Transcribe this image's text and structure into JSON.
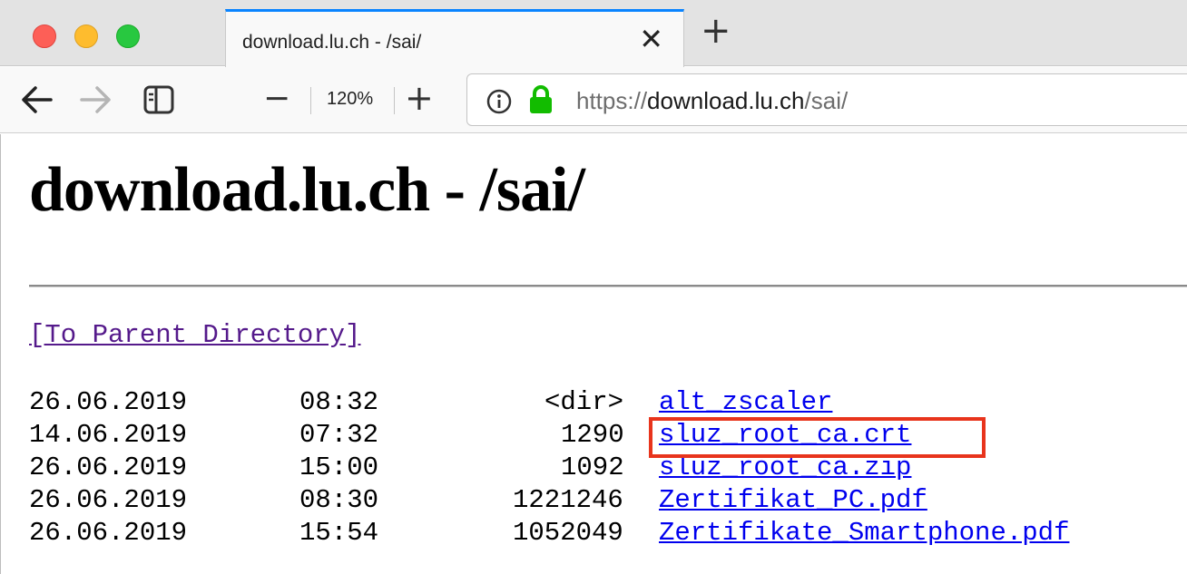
{
  "tab": {
    "title": "download.lu.ch - /sai/",
    "close_glyph": "✕",
    "new_tab_glyph": "+"
  },
  "nav": {
    "back_icon": "back-arrow-icon",
    "forward_icon": "forward-arrow-icon",
    "reader_icon": "reader-view-icon",
    "zoom_out_glyph": "−",
    "zoom_level": "120%",
    "zoom_in_glyph": "+",
    "url_prefix": "https://",
    "url_host": "download.lu.ch",
    "url_path": "/sai/"
  },
  "page": {
    "title": "download.lu.ch - /sai/",
    "parent_link": "[To Parent Directory]",
    "entries": [
      {
        "date": "26.06.2019",
        "time": "08:32",
        "size": "<dir>",
        "name": "alt_zscaler"
      },
      {
        "date": "14.06.2019",
        "time": "07:32",
        "size": "1290",
        "name": "sluz_root_ca.crt"
      },
      {
        "date": "26.06.2019",
        "time": "15:00",
        "size": "1092",
        "name": "sluz_root_ca.zip"
      },
      {
        "date": "26.06.2019",
        "time": "08:30",
        "size": "1221246",
        "name": "Zertifikat_PC.pdf"
      },
      {
        "date": "26.06.2019",
        "time": "15:54",
        "size": "1052049",
        "name": "Zertifikate_Smartphone.pdf"
      }
    ]
  },
  "colors": {
    "link_unvisited": "#0000ee",
    "link_visited": "#551a8b",
    "highlight": "#e8341c",
    "lock_green": "#12bc00",
    "tab_accent": "#0a84ff"
  }
}
